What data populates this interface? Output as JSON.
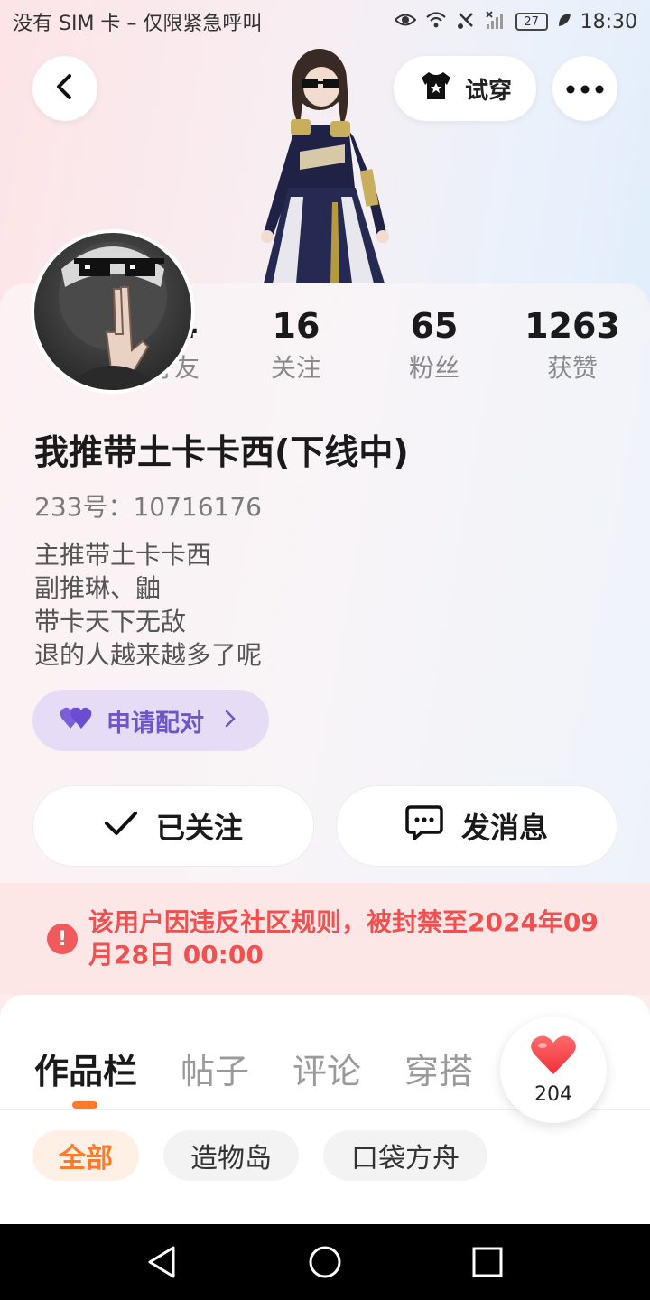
{
  "status_bar": {
    "carrier": "没有 SIM 卡 – 仅限紧急呼叫",
    "battery": "27",
    "time": "18:30"
  },
  "top_bar": {
    "try_on_label": "试穿"
  },
  "stats": [
    {
      "value": "44",
      "label": "好友"
    },
    {
      "value": "16",
      "label": "关注"
    },
    {
      "value": "65",
      "label": "粉丝"
    },
    {
      "value": "1263",
      "label": "获赞"
    }
  ],
  "profile": {
    "username": "我推带土卡卡西(下线中)",
    "uid": "233号：10716176",
    "bio": [
      "主推带土卡卡西",
      "副推琳、鼬",
      "带卡天下无敌",
      "退的人越来越多了呢"
    ]
  },
  "pair_button_label": "申请配对",
  "actions": {
    "follow_label": "已关注",
    "message_label": "发消息"
  },
  "ban_notice": "该用户因违反社区规则，被封禁至2024年09月28日 00:00",
  "tabs": [
    {
      "label": "作品栏",
      "active": true
    },
    {
      "label": "帖子",
      "active": false
    },
    {
      "label": "评论",
      "active": false
    },
    {
      "label": "穿搭",
      "active": false
    }
  ],
  "likes_count": "204",
  "filters": [
    {
      "label": "全部",
      "active": true
    },
    {
      "label": "造物岛",
      "active": false
    },
    {
      "label": "口袋方舟",
      "active": false
    }
  ],
  "colors": {
    "accent_orange": "#ff7a2a",
    "ban_red": "#f05050",
    "pair_purple": "#6f56c6"
  }
}
